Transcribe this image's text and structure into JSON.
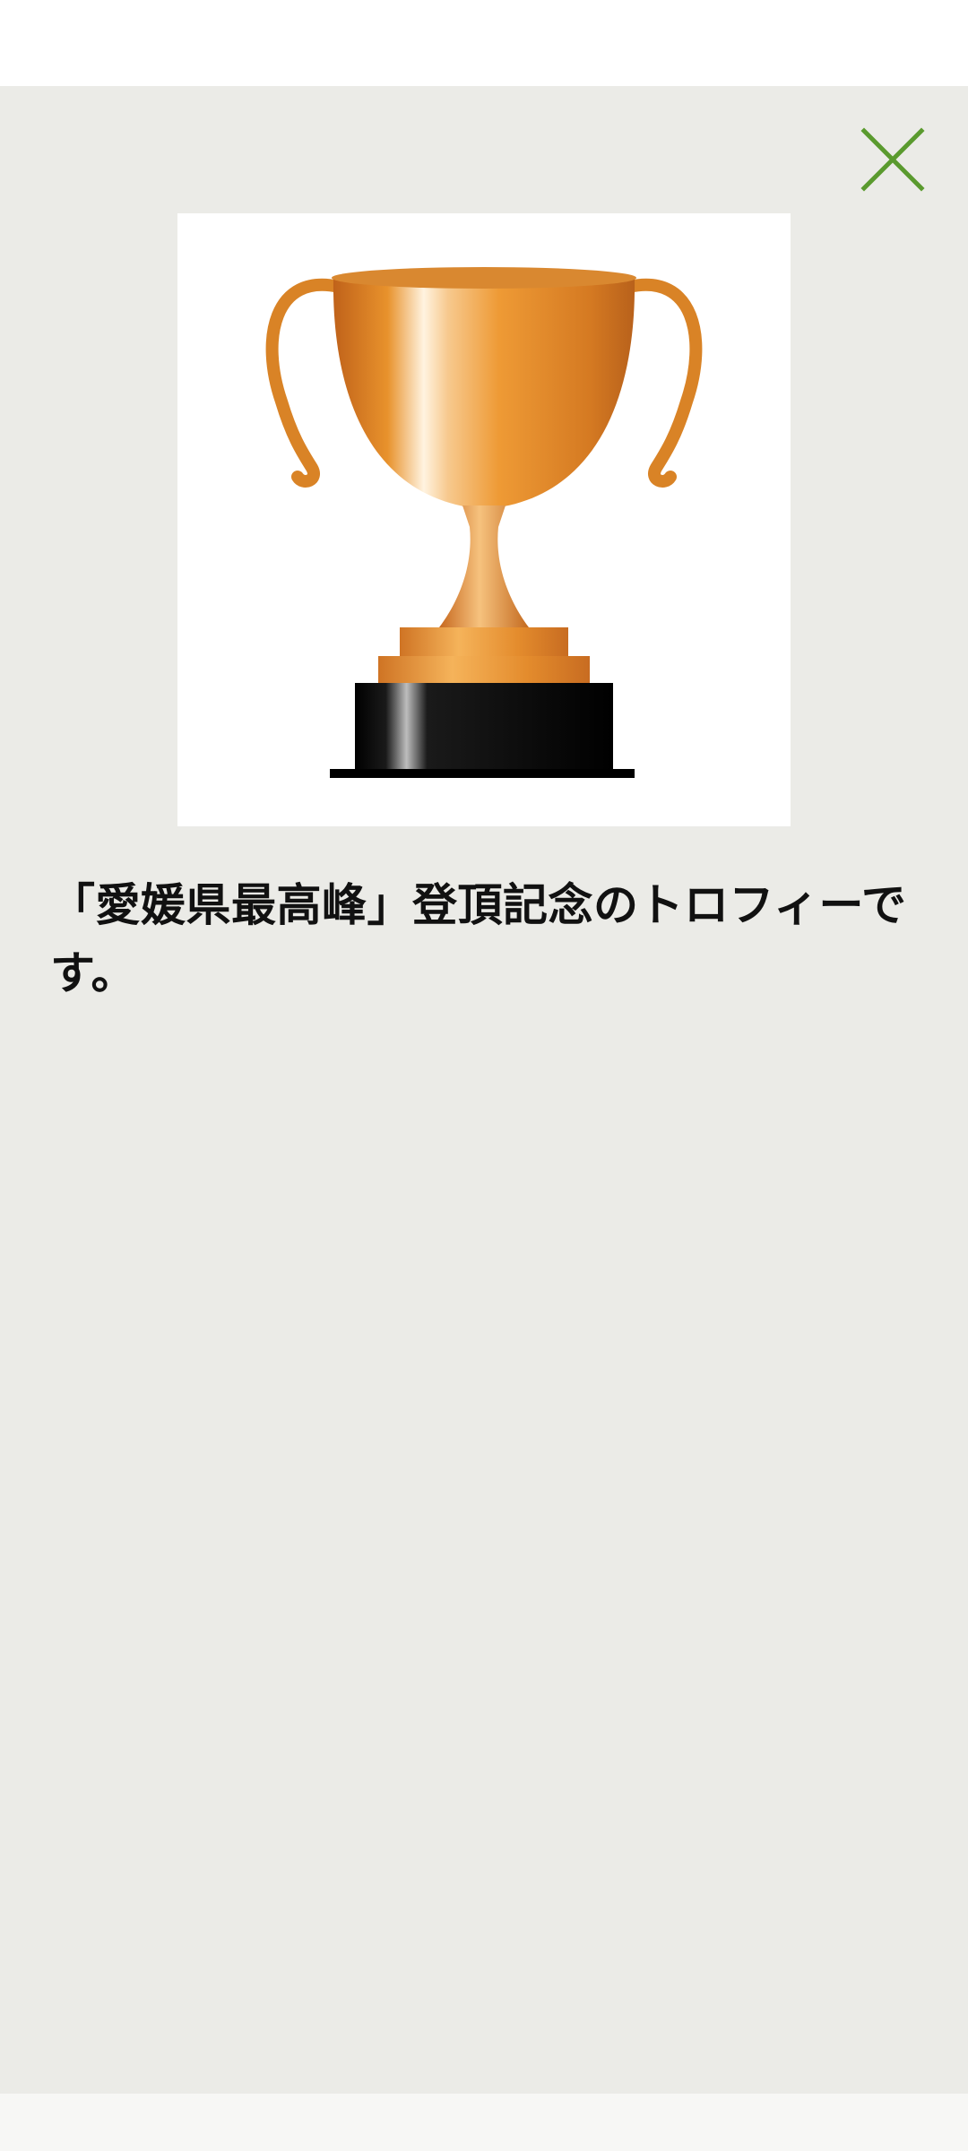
{
  "dialog": {
    "description": "「愛媛県最高峰」登頂記念のトロフィーです。"
  },
  "icons": {
    "close": "close-icon",
    "trophy": "trophy-image"
  },
  "colors": {
    "sheet_background": "#ebebe7",
    "close_icon": "#5a9a2e",
    "trophy_gold": "#e8962a",
    "trophy_base": "#000000",
    "text": "#111111"
  }
}
